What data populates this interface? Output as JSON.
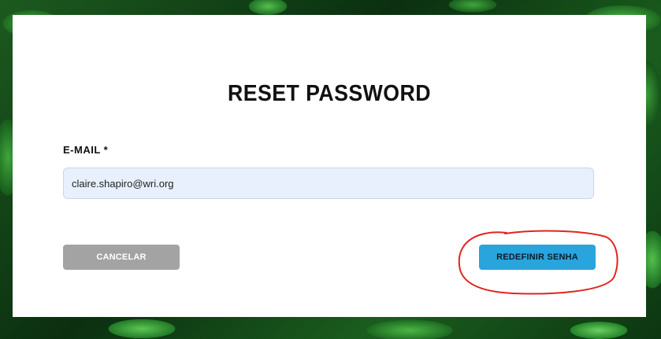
{
  "form": {
    "title": "RESET PASSWORD",
    "email_label": "E-MAIL *",
    "email_value": "claire.shapiro@wri.org"
  },
  "buttons": {
    "cancel_label": "CANCELAR",
    "submit_label": "REDEFINIR SENHA"
  },
  "colors": {
    "card_background": "#ffffff",
    "input_background": "#e8f0fe",
    "cancel_button": "#a3a3a3",
    "submit_button": "#2aa4dc",
    "annotation_circle": "#e0251f"
  }
}
